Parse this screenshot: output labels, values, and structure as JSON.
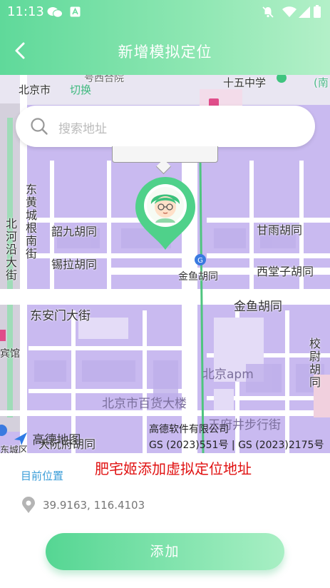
{
  "status_bar": {
    "time": "11:13"
  },
  "header": {
    "title": "新增模拟定位"
  },
  "search": {
    "placeholder": "搜索地址"
  },
  "map": {
    "labels": {
      "beijing": "北京市",
      "switch": "切换",
      "school15": "十五中学",
      "top_partial": "号西合院",
      "nan_partial": "(南",
      "dong_huangcheng": "东黄城根南街",
      "beiheyan": "北河沿大街",
      "shaojiu": "韶九胡同",
      "xila": "锡拉胡同",
      "ganyu": "甘雨胡同",
      "jinyu_small": "金鱼胡同",
      "xitangzi": "西堂子胡同",
      "jinyu": "金鱼胡同",
      "donganmen": "东安门大街",
      "binguan": "宾馆",
      "xiaowei": "校尉胡同",
      "beijing_apm": "北京apm",
      "baihuo": "北京市百货大楼",
      "wangfujing": "王府井步行街",
      "dacheng": "大阮府胡同",
      "dongcheng": "东城区"
    },
    "amap_logo": "高德地图",
    "credit_company": "高德软件有限公司",
    "credit_gs": "GS (2023)551号 | GS (2023)2175号"
  },
  "overlay_text": "肥宅姬添加虚拟定位地址",
  "current_location": {
    "label": "目前位置",
    "coordinates": "39.9163, 116.4103"
  },
  "add_button": {
    "label": "添加"
  },
  "colors": {
    "accent": "#5fd99a",
    "map_fill": "#c8b8ef",
    "overlay_red": "#e01010",
    "link_blue": "#3a9dd8"
  }
}
